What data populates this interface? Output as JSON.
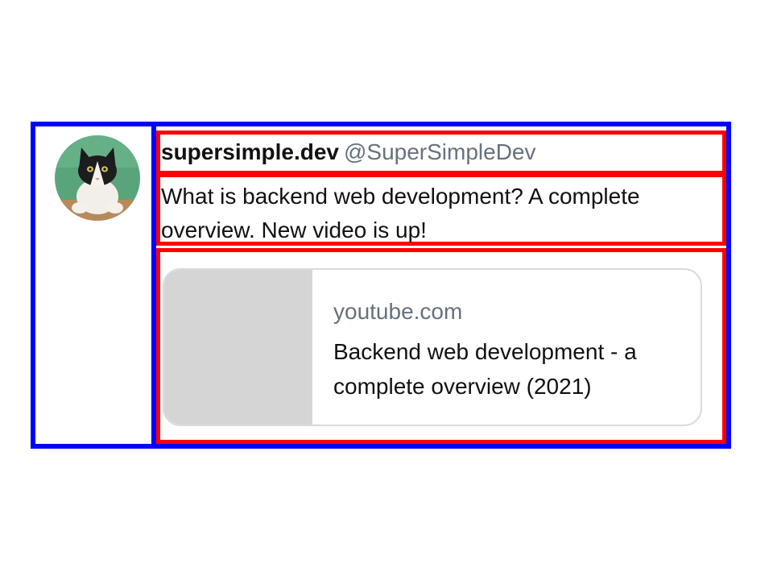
{
  "author": {
    "name": "supersimple.dev",
    "handle": "@SuperSimpleDev",
    "avatar_icon": "cat-avatar-icon"
  },
  "tweet": {
    "text": "What is backend web development? A complete overview. New video is up!"
  },
  "link_card": {
    "domain": "youtube.com",
    "title": "Backend web development - a complete overview (2021)"
  },
  "colors": {
    "outline_blue": "#0000ff",
    "outline_red": "#ff0000",
    "handle_gray": "#66727e",
    "thumbnail_gray": "#d5d5d5",
    "card_border": "#d7dbdf"
  }
}
